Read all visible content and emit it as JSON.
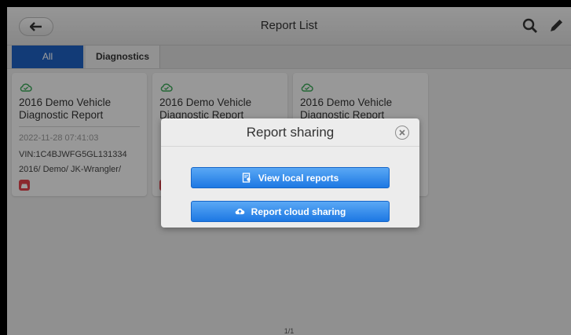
{
  "header": {
    "title": "Report List"
  },
  "tabs": [
    {
      "label": "All",
      "active": true
    },
    {
      "label": "Diagnostics",
      "active": false
    }
  ],
  "cards": [
    {
      "title": "2016 Demo Vehicle Diagnostic Report",
      "date": "2022-11-28 07:41:03",
      "vin": "VIN:1C4BJWFG5GL131334",
      "model": "2016/ Demo/ JK-Wrangler/"
    },
    {
      "title": "2016 Demo Vehicle Diagnostic Report"
    },
    {
      "title": "2016 Demo Vehicle Diagnostic Report"
    }
  ],
  "pager": {
    "text": "1/1"
  },
  "dialog": {
    "title": "Report sharing",
    "buttons": [
      {
        "label": "View local reports",
        "icon": "local-report-icon"
      },
      {
        "label": "Report cloud sharing",
        "icon": "cloud-upload-icon"
      }
    ]
  },
  "colors": {
    "accent": "#1d5fc0",
    "button": "#1d78e3",
    "status_ok": "#3aa757",
    "car_badge": "#e0434b"
  }
}
